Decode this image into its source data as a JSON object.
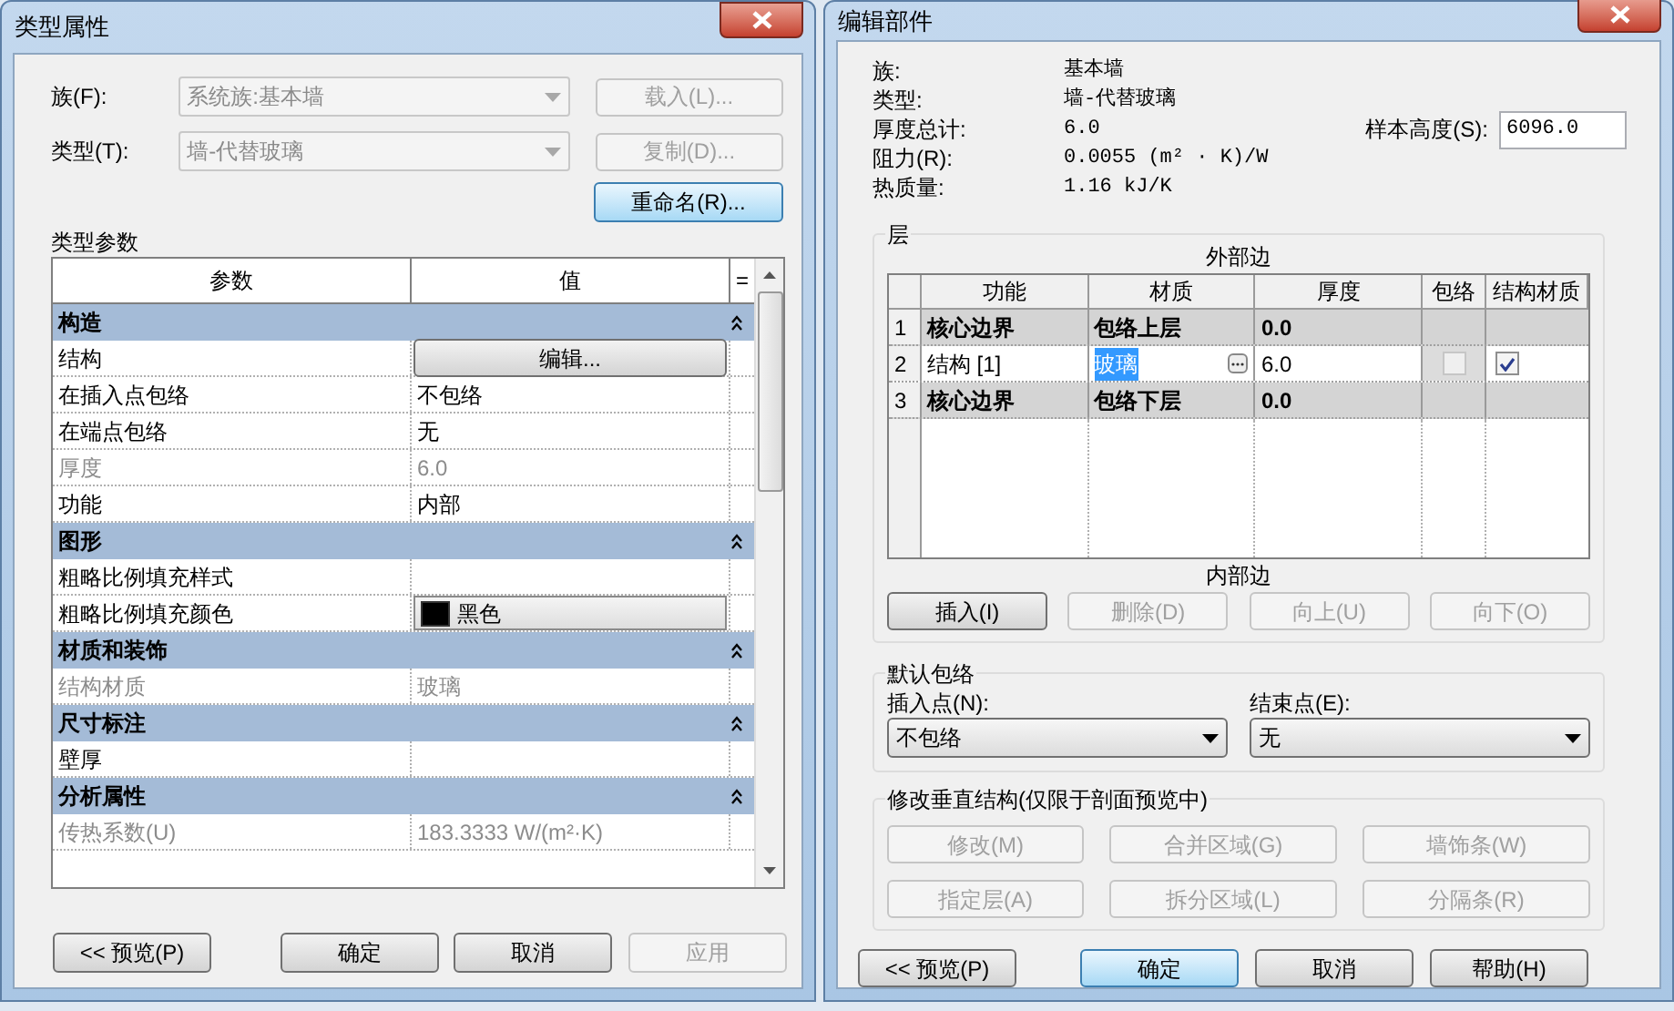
{
  "type_properties": {
    "title": "类型属性",
    "fields": [
      {
        "label": "族(F):",
        "value": "系统族:基本墙",
        "disabled": true,
        "button": {
          "label": "载入(L)...",
          "disabled": true
        }
      },
      {
        "label": "类型(T):",
        "value": "墙-代替玻璃",
        "disabled": true,
        "button": {
          "label": "复制(D)...",
          "disabled": true
        }
      }
    ],
    "rename_button": {
      "label": "重命名(R)...",
      "focused": true
    },
    "section_label": "类型参数",
    "columns": [
      "参数",
      "值"
    ],
    "filter_symbol": "=",
    "groups": [
      {
        "title": "构造",
        "expanded": true,
        "rows": [
          {
            "name": "结构",
            "kind": "button",
            "value": "编辑...",
            "disabled": false
          },
          {
            "name": "在插入点包络",
            "kind": "text",
            "value": "不包络",
            "disabled": false
          },
          {
            "name": "在端点包络",
            "kind": "text",
            "value": "无",
            "disabled": false
          },
          {
            "name": "厚度",
            "kind": "text",
            "value": "6.0",
            "disabled": true
          },
          {
            "name": "功能",
            "kind": "text",
            "value": "内部",
            "disabled": false
          }
        ]
      },
      {
        "title": "图形",
        "expanded": true,
        "rows": [
          {
            "name": "粗略比例填充样式",
            "kind": "text",
            "disabled": false
          },
          {
            "name": "粗略比例填充颜色",
            "kind": "color",
            "value": "黑色",
            "color": "#000000",
            "disabled": false
          }
        ]
      },
      {
        "title": "材质和装饰",
        "expanded": true,
        "rows": [
          {
            "name": "结构材质",
            "kind": "text",
            "value": "玻璃",
            "disabled": true
          }
        ]
      },
      {
        "title": "尺寸标注",
        "expanded": true,
        "rows": [
          {
            "name": "壁厚",
            "kind": "text",
            "disabled": false
          }
        ]
      },
      {
        "title": "分析属性",
        "expanded": true,
        "rows": [
          {
            "name": "传热系数(U)",
            "kind": "text",
            "value": "183.3333 W/(m²·K)",
            "disabled": true
          }
        ]
      }
    ],
    "buttons": [
      {
        "label": "<< 预览(P)",
        "disabled": false,
        "default": false
      },
      {
        "label": "确定",
        "disabled": false,
        "default": false
      },
      {
        "label": "取消",
        "disabled": false,
        "default": false
      },
      {
        "label": "应用",
        "disabled": true,
        "default": false
      }
    ]
  },
  "edit_assembly": {
    "title": "编辑部件",
    "info": [
      {
        "label": "族:",
        "value": "基本墙"
      },
      {
        "label": "类型:",
        "value": "墙-代替玻璃"
      },
      {
        "label": "厚度总计:",
        "value": "6.0"
      },
      {
        "label": "阻力(R):",
        "value": "0.0055 (m² · K)/W"
      },
      {
        "label": "热质量:",
        "value": "1.16 kJ/K"
      }
    ],
    "sample_height": {
      "label": "样本高度(S):",
      "value": "6096.0"
    },
    "layers": {
      "title": "层",
      "top_label": "外部边",
      "bottom_label": "内部边",
      "columns": [
        "功能",
        "材质",
        "厚度",
        "包络",
        "结构材质"
      ],
      "rows": [
        {
          "number": "1",
          "kind": "boundary",
          "function": "核心边界",
          "material": "包络上层",
          "thickness": "0.0"
        },
        {
          "number": "2",
          "kind": "layer",
          "function": "结构 [1]",
          "material": "玻璃",
          "material_selected": true,
          "thickness": "6.0",
          "wraps": {
            "checked": false,
            "disabled": true
          },
          "structural_material": {
            "checked": true,
            "disabled": false
          }
        },
        {
          "number": "3",
          "kind": "boundary",
          "function": "核心边界",
          "material": "包络下层",
          "thickness": "0.0"
        }
      ],
      "buttons": [
        {
          "label": "插入(I)",
          "disabled": false
        },
        {
          "label": "删除(D)",
          "disabled": true
        },
        {
          "label": "向上(U)",
          "disabled": true
        },
        {
          "label": "向下(O)",
          "disabled": true
        }
      ]
    },
    "default_wrapping": {
      "title": "默认包络",
      "insert_point": {
        "label": "插入点(N):",
        "value": "不包络"
      },
      "end_point": {
        "label": "结束点(E):",
        "value": "无"
      }
    },
    "vertical_structure": {
      "title": "修改垂直结构(仅限于剖面预览中)",
      "buttons": [
        {
          "label": "修改(M)",
          "disabled": true
        },
        {
          "label": "合并区域(G)",
          "disabled": true
        },
        {
          "label": "墙饰条(W)",
          "disabled": true
        },
        {
          "label": "指定层(A)",
          "disabled": true
        },
        {
          "label": "拆分区域(L)",
          "disabled": true
        },
        {
          "label": "分隔条(R)",
          "disabled": true
        }
      ]
    },
    "buttons": [
      {
        "label": "<< 预览(P)",
        "disabled": false,
        "default": false
      },
      {
        "label": "确定",
        "disabled": false,
        "default": true
      },
      {
        "label": "取消",
        "disabled": false,
        "default": false
      },
      {
        "label": "帮助(H)",
        "disabled": false,
        "default": false
      }
    ]
  }
}
